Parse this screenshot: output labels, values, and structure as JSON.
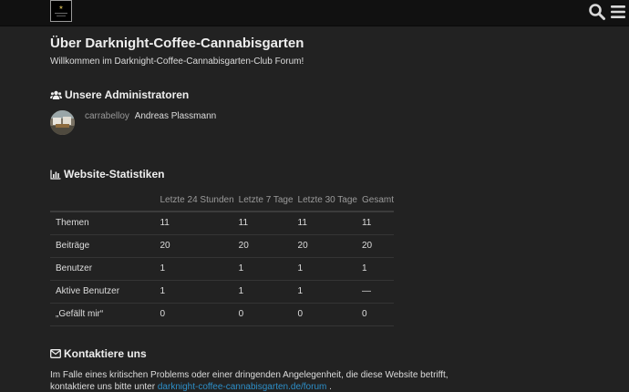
{
  "header": {
    "logo_icon": "forum-logo",
    "search_icon": "search-icon",
    "menu_icon": "hamburger-menu-icon"
  },
  "about": {
    "title": "Über Darknight-Coffee-Cannabisgarten",
    "welcome": "Willkommen im Darknight-Coffee-Cannabisgarten-Club Forum!"
  },
  "admins": {
    "heading": "Unsere Administratoren",
    "icon": "users-icon",
    "list": [
      {
        "username": "carrabelloy",
        "name": "Andreas Plassmann"
      }
    ]
  },
  "stats": {
    "heading": "Website-Statistiken",
    "icon": "bar-chart-icon",
    "columns": [
      "",
      "Letzte 24 Stunden",
      "Letzte 7 Tage",
      "Letzte 30 Tage",
      "Gesamt"
    ],
    "rows": [
      {
        "label": "Themen",
        "values": [
          "11",
          "11",
          "11",
          "11"
        ]
      },
      {
        "label": "Beiträge",
        "values": [
          "20",
          "20",
          "20",
          "20"
        ]
      },
      {
        "label": "Benutzer",
        "values": [
          "1",
          "1",
          "1",
          "1"
        ]
      },
      {
        "label": "Aktive Benutzer",
        "values": [
          "1",
          "1",
          "1",
          "—"
        ]
      },
      {
        "label": "„Gefällt mir“",
        "values": [
          "0",
          "0",
          "0",
          "0"
        ]
      }
    ]
  },
  "contact": {
    "heading": "Kontaktiere uns",
    "icon": "envelope-icon",
    "text_line1": "Im Falle eines kritischen Problems oder einer dringenden Angelegenheit, die diese Website betrifft,",
    "text_line2_before": "kontaktiere uns bitte unter",
    "link_text": "darknight-coffee-cannabisgarten.de/forum",
    "text_line2_after": "."
  },
  "colors": {
    "background": "#222222",
    "header": "#111111",
    "link": "#2d8fc9",
    "muted": "#9a9a9a"
  }
}
